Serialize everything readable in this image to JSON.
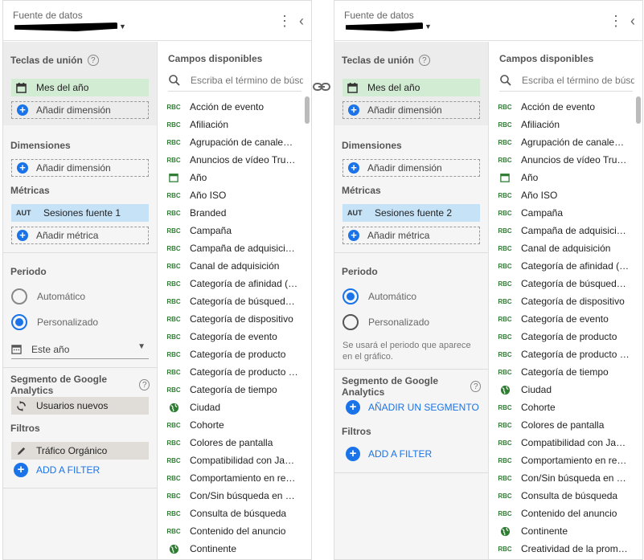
{
  "left_panel": {
    "header": {
      "label": "Fuente de datos"
    },
    "join_keys": {
      "title": "Teclas de unión",
      "chip": "Mes del año",
      "add": "Añadir dimensión"
    },
    "dimensions": {
      "title": "Dimensiones",
      "add": "Añadir dimensión"
    },
    "metrics": {
      "title": "Métricas",
      "chip_type": "AUT",
      "chip": "Sesiones fuente 1",
      "add": "Añadir métrica"
    },
    "period": {
      "title": "Periodo",
      "auto": "Automático",
      "custom": "Personalizado",
      "date_value": "Este año"
    },
    "segment": {
      "title": "Segmento de Google Analytics",
      "chip": "Usuarios nuevos"
    },
    "filters": {
      "title": "Filtros",
      "chip": "Tráfico Orgánico",
      "add": "ADD A FILTER"
    },
    "fields": {
      "title": "Campos disponibles",
      "search_placeholder": "Escriba el término de búsqueda",
      "items": [
        {
          "icon": "abc",
          "label": "Acción de evento"
        },
        {
          "icon": "abc",
          "label": "Afiliación"
        },
        {
          "icon": "abc",
          "label": "Agrupación de canale…"
        },
        {
          "icon": "abc",
          "label": "Anuncios de vídeo Tru…"
        },
        {
          "icon": "calendar",
          "label": "Año"
        },
        {
          "icon": "abc",
          "label": "Año ISO"
        },
        {
          "icon": "abc",
          "label": "Branded"
        },
        {
          "icon": "abc",
          "label": "Campaña"
        },
        {
          "icon": "abc",
          "label": "Campaña de adquisici…"
        },
        {
          "icon": "abc",
          "label": "Canal de adquisición"
        },
        {
          "icon": "abc",
          "label": "Categoría de afinidad (…"
        },
        {
          "icon": "abc",
          "label": "Categoría de búsqued…"
        },
        {
          "icon": "abc",
          "label": "Categoría de dispositivo"
        },
        {
          "icon": "abc",
          "label": "Categoría de evento"
        },
        {
          "icon": "abc",
          "label": "Categoría de producto"
        },
        {
          "icon": "abc",
          "label": "Categoría de producto …"
        },
        {
          "icon": "abc",
          "label": "Categoría de tiempo"
        },
        {
          "icon": "globe",
          "label": "Ciudad"
        },
        {
          "icon": "abc",
          "label": "Cohorte"
        },
        {
          "icon": "abc",
          "label": "Colores de pantalla"
        },
        {
          "icon": "abc",
          "label": "Compatibilidad con Ja…"
        },
        {
          "icon": "abc",
          "label": "Comportamiento en re…"
        },
        {
          "icon": "abc",
          "label": "Con/Sin búsqueda en …"
        },
        {
          "icon": "abc",
          "label": "Consulta de búsqueda"
        },
        {
          "icon": "abc",
          "label": "Contenido del anuncio"
        },
        {
          "icon": "globe",
          "label": "Continente"
        }
      ]
    }
  },
  "right_panel": {
    "header": {
      "label": "Fuente de datos"
    },
    "join_keys": {
      "title": "Teclas de unión",
      "chip": "Mes del año",
      "add": "Añadir dimensión"
    },
    "dimensions": {
      "title": "Dimensiones",
      "add": "Añadir dimensión"
    },
    "metrics": {
      "title": "Métricas",
      "chip_type": "AUT",
      "chip": "Sesiones fuente 2",
      "add": "Añadir métrica"
    },
    "period": {
      "title": "Periodo",
      "auto": "Automático",
      "custom": "Personalizado",
      "note": "Se usará el periodo que aparece en el gráfico."
    },
    "segment": {
      "title": "Segmento de Google Analytics",
      "add": "AÑADIR UN SEGMENTO"
    },
    "filters": {
      "title": "Filtros",
      "add": "ADD A FILTER"
    },
    "fields": {
      "title": "Campos disponibles",
      "search_placeholder": "Escriba el término de búsqueda",
      "items": [
        {
          "icon": "abc",
          "label": "Acción de evento"
        },
        {
          "icon": "abc",
          "label": "Afiliación"
        },
        {
          "icon": "abc",
          "label": "Agrupación de canale…"
        },
        {
          "icon": "abc",
          "label": "Anuncios de vídeo Tru…"
        },
        {
          "icon": "calendar",
          "label": "Año"
        },
        {
          "icon": "abc",
          "label": "Año ISO"
        },
        {
          "icon": "abc",
          "label": "Campaña"
        },
        {
          "icon": "abc",
          "label": "Campaña de adquisici…"
        },
        {
          "icon": "abc",
          "label": "Canal de adquisición"
        },
        {
          "icon": "abc",
          "label": "Categoría de afinidad (…"
        },
        {
          "icon": "abc",
          "label": "Categoría de búsqued…"
        },
        {
          "icon": "abc",
          "label": "Categoría de dispositivo"
        },
        {
          "icon": "abc",
          "label": "Categoría de evento"
        },
        {
          "icon": "abc",
          "label": "Categoría de producto"
        },
        {
          "icon": "abc",
          "label": "Categoría de producto …"
        },
        {
          "icon": "abc",
          "label": "Categoría de tiempo"
        },
        {
          "icon": "globe",
          "label": "Ciudad"
        },
        {
          "icon": "abc",
          "label": "Cohorte"
        },
        {
          "icon": "abc",
          "label": "Colores de pantalla"
        },
        {
          "icon": "abc",
          "label": "Compatibilidad con Ja…"
        },
        {
          "icon": "abc",
          "label": "Comportamiento en re…"
        },
        {
          "icon": "abc",
          "label": "Con/Sin búsqueda en …"
        },
        {
          "icon": "abc",
          "label": "Consulta de búsqueda"
        },
        {
          "icon": "abc",
          "label": "Contenido del anuncio"
        },
        {
          "icon": "globe",
          "label": "Continente"
        },
        {
          "icon": "abc",
          "label": "Creatividad de la prom…"
        }
      ]
    }
  },
  "colors": {
    "accent": "#1a73e8",
    "join_chip": "#d2ebd3",
    "metric_chip": "#c6e2f7",
    "segment_chip": "#e0ddd9",
    "field_icon": "#2e7d32"
  }
}
